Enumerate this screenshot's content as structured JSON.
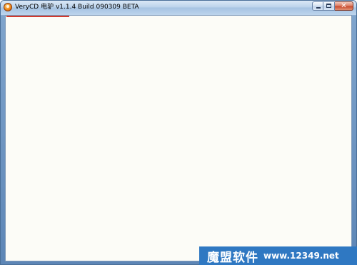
{
  "window": {
    "title": "VeryCD 电驴 v1.1.4 Build 090309 BETA",
    "app_icon": "verycd-emule-icon",
    "buttons": {
      "minimize_glyph": "",
      "maximize_glyph": "",
      "close_glyph": "✕"
    }
  },
  "content": {
    "background_color": "#fcfcf7",
    "loading_bar_color": "#d23a2f"
  },
  "watermark": {
    "brand": "魔盟软件",
    "url": "www.12349.net",
    "background_color": "#2f78c2"
  }
}
